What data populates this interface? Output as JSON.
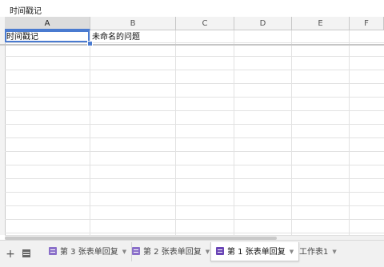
{
  "formula_bar": {
    "value": "时间戳记"
  },
  "columns": [
    "A",
    "B",
    "C",
    "D",
    "E",
    "F"
  ],
  "cells": {
    "A1": "时间戳记",
    "B1": "未命名的问题"
  },
  "toolbar": {
    "add_sheet": "+",
    "sheet_list": "≡"
  },
  "tabs": [
    {
      "label": "第 3 张表单回复",
      "caret": "▼"
    },
    {
      "label": "第 2 张表单回复",
      "caret": "▼"
    },
    {
      "label": "第 1 张表单回复",
      "caret": "▼"
    },
    {
      "label": "工作表1",
      "caret": "▼"
    }
  ],
  "colors": {
    "accent": "#4a7bd0",
    "form_icon": "#6a45b6"
  }
}
